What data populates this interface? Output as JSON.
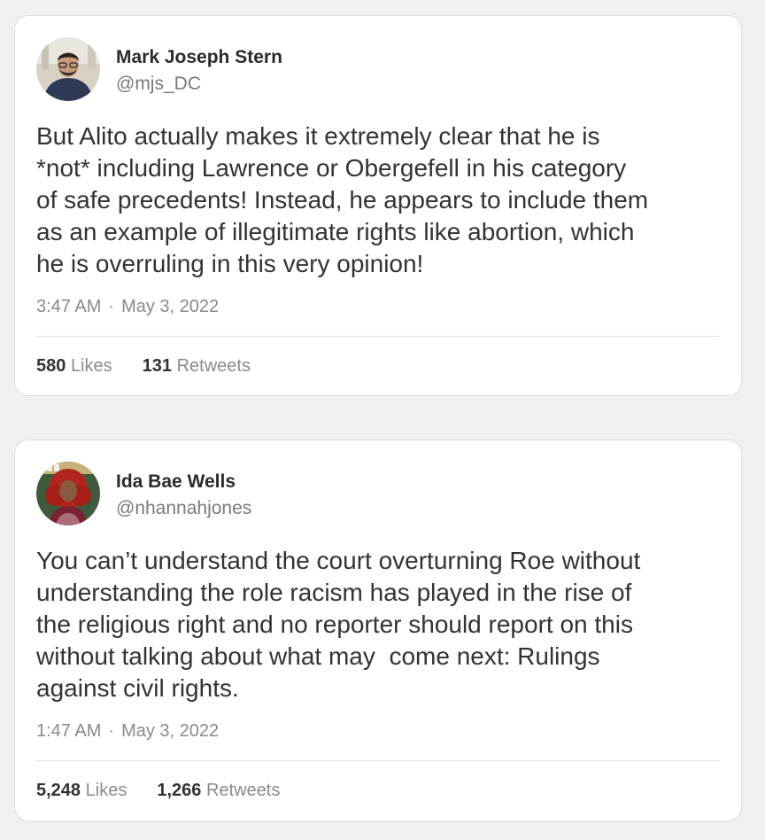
{
  "tweets": [
    {
      "author_name": "Mark Joseph Stern",
      "handle": "@mjs_DC",
      "avatar_icon": "user-avatar-photo",
      "text_lines": [
        "But Alito actually makes it extremely clear that he is",
        "*not* including Lawrence or Obergefell in his category",
        "of safe precedents! Instead, he appears to include them",
        "as an example of illegitimate rights like abortion, which",
        "he is overruling in this very opinion!"
      ],
      "time": "3:47 AM",
      "separator": "·",
      "date": "May 3, 2022",
      "likes_count": "580",
      "likes_label": "Likes",
      "retweets_count": "131",
      "retweets_label": "Retweets"
    },
    {
      "author_name": "Ida Bae Wells",
      "handle": "@nhannahjones",
      "avatar_icon": "user-avatar-photo",
      "text_lines": [
        "You can’t understand the court overturning Roe without",
        "understanding the role racism has played in the rise of",
        "the religious right and no reporter should report on this",
        "without talking about what may  come next: Rulings",
        "against civil rights."
      ],
      "time": "1:47 AM",
      "separator": "·",
      "date": "May 3, 2022",
      "likes_count": "5,248",
      "likes_label": "Likes",
      "retweets_count": "1,266",
      "retweets_label": "Retweets"
    }
  ],
  "colors": {
    "background": "#f0f0f0",
    "card": "#ffffff",
    "text": "#333333",
    "muted": "#8a8a8a"
  }
}
